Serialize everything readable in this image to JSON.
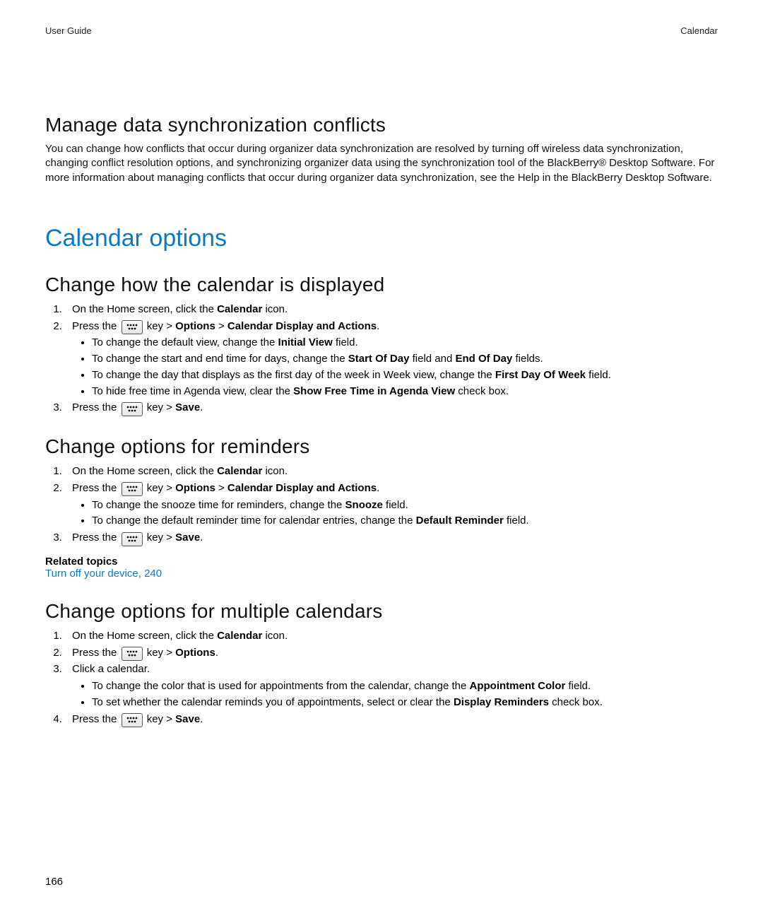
{
  "header": {
    "left": "User Guide",
    "right": "Calendar"
  },
  "page_number": "166",
  "sec_manage": {
    "heading": "Manage data synchronization conflicts",
    "body": "You can change how conflicts that occur during organizer data synchronization are resolved by turning off wireless data synchronization, changing conflict resolution options, and synchronizing organizer data using the synchronization tool of the BlackBerry® Desktop Software. For more information about managing conflicts that occur during organizer data synchronization, see the Help in the BlackBerry Desktop Software."
  },
  "chapter": {
    "heading": "Calendar options"
  },
  "sec_display": {
    "heading": "Change how the calendar is displayed",
    "step1_a": "On the Home screen, click the ",
    "step1_b": "Calendar",
    "step1_c": " icon.",
    "step2_a": "Press the ",
    "step2_b": " key > ",
    "step2_c": "Options",
    "step2_d": " > ",
    "step2_e": "Calendar Display and Actions",
    "step2_f": ".",
    "bullet1_a": "To change the default view, change the ",
    "bullet1_b": "Initial View",
    "bullet1_c": " field.",
    "bullet2_a": "To change the start and end time for days, change the ",
    "bullet2_b": "Start Of Day",
    "bullet2_c": " field and ",
    "bullet2_d": "End Of Day",
    "bullet2_e": " fields.",
    "bullet3_a": "To change the day that displays as the first day of the week in Week view, change the ",
    "bullet3_b": "First Day Of Week",
    "bullet3_c": " field.",
    "bullet4_a": "To hide free time in Agenda view, clear the ",
    "bullet4_b": "Show Free Time in Agenda View",
    "bullet4_c": " check box.",
    "step3_a": "Press the ",
    "step3_b": " key > ",
    "step3_c": "Save",
    "step3_d": "."
  },
  "sec_reminders": {
    "heading": "Change options for reminders",
    "step1_a": "On the Home screen, click the ",
    "step1_b": "Calendar",
    "step1_c": " icon.",
    "step2_a": "Press the ",
    "step2_b": " key > ",
    "step2_c": "Options",
    "step2_d": " > ",
    "step2_e": "Calendar Display and Actions",
    "step2_f": ".",
    "bullet1_a": "To change the snooze time for reminders, change the ",
    "bullet1_b": "Snooze",
    "bullet1_c": " field.",
    "bullet2_a": "To change the default reminder time for calendar entries, change the ",
    "bullet2_b": "Default Reminder",
    "bullet2_c": " field.",
    "step3_a": "Press the ",
    "step3_b": " key > ",
    "step3_c": "Save",
    "step3_d": ".",
    "related_heading": "Related topics",
    "related_link": "Turn off your device, 240"
  },
  "sec_multical": {
    "heading": "Change options for multiple calendars",
    "step1_a": "On the Home screen, click the ",
    "step1_b": "Calendar",
    "step1_c": " icon.",
    "step2_a": "Press the ",
    "step2_b": " key > ",
    "step2_c": "Options",
    "step2_d": ".",
    "step3": "Click a calendar.",
    "bullet1_a": "To change the color that is used for appointments from the calendar, change the ",
    "bullet1_b": "Appointment Color",
    "bullet1_c": " field.",
    "bullet2_a": "To set whether the calendar reminds you of appointments, select or clear the ",
    "bullet2_b": "Display Reminders",
    "bullet2_c": " check box.",
    "step4_a": "Press the ",
    "step4_b": " key > ",
    "step4_c": "Save",
    "step4_d": "."
  }
}
